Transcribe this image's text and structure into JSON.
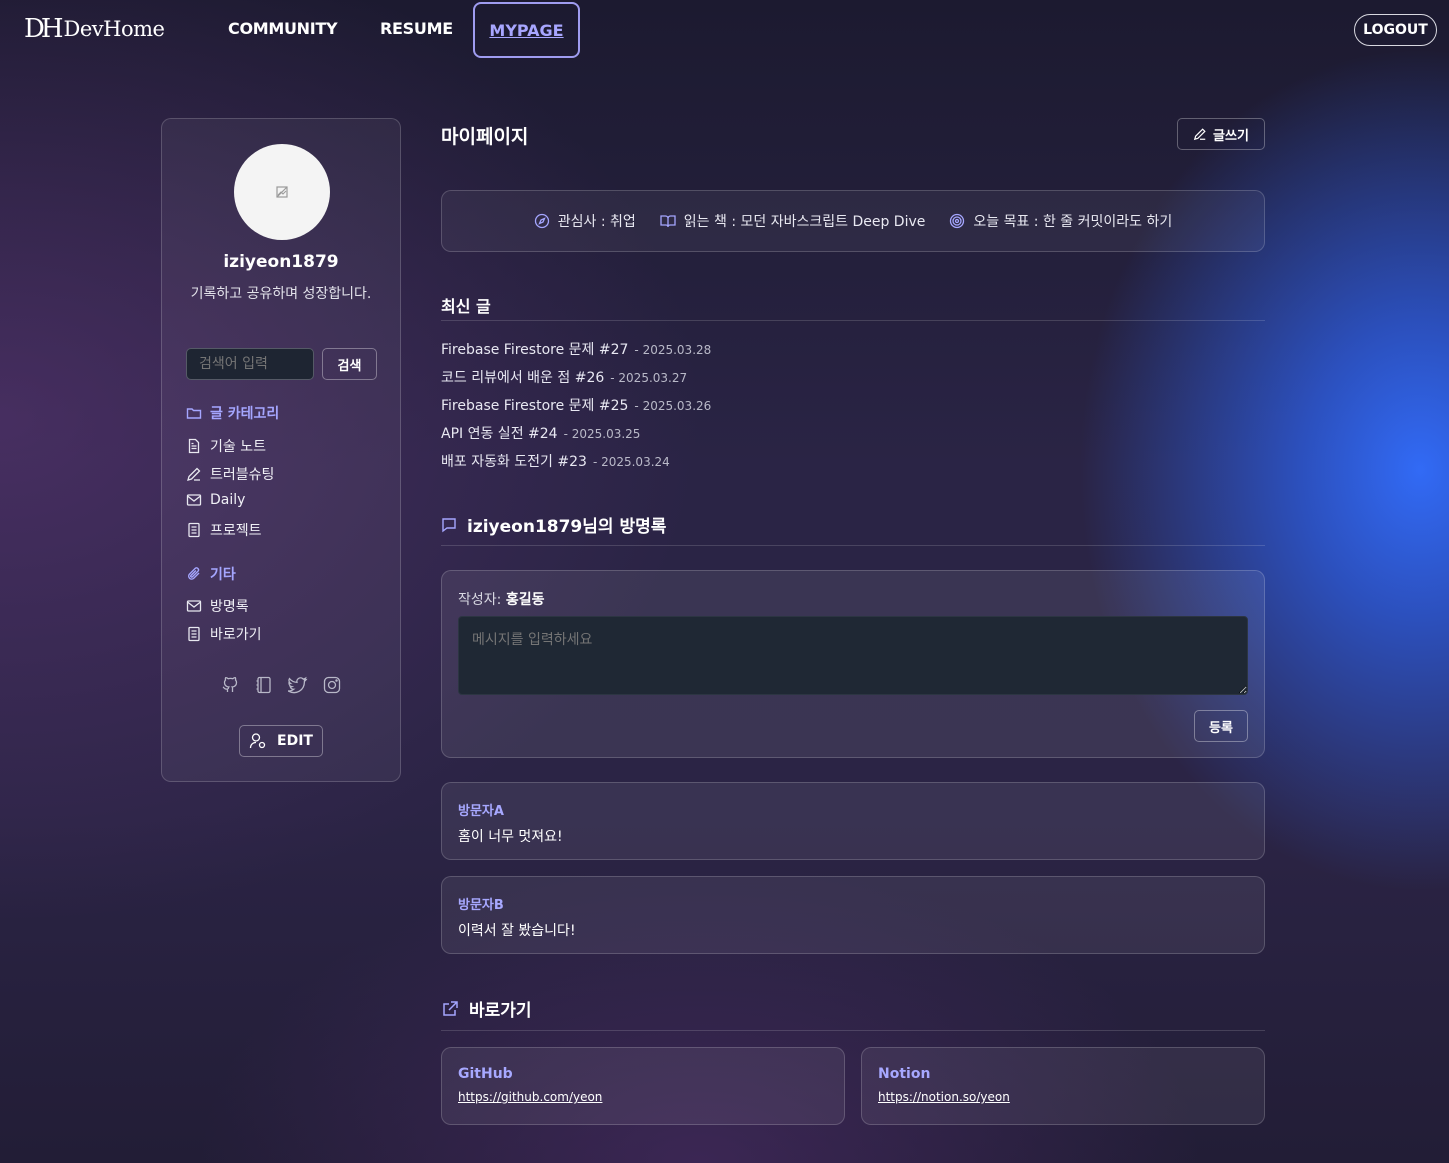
{
  "nav": {
    "logo_mark": "DH",
    "logo_text": "DevHome",
    "links": [
      "COMMUNITY",
      "RESUME",
      "MYPAGE"
    ],
    "logout": "LOGOUT"
  },
  "profile": {
    "username": "iziyeon1879",
    "bio": "기록하고 공유하며 성장합니다.",
    "search_placeholder": "검색어 입력",
    "search_button": "검색",
    "edit_button": "EDIT"
  },
  "categories": {
    "heading": "글 카테고리",
    "items": [
      "기술 노트",
      "트러블슈팅",
      "Daily",
      "프로젝트"
    ]
  },
  "etc": {
    "heading": "기타",
    "items": [
      "방명록",
      "바로가기"
    ]
  },
  "main": {
    "title": "마이페이지",
    "write_button": "글쓰기",
    "info": {
      "interest": "관심사 : 취업",
      "book": "읽는 책 : 모던 자바스크립트 Deep Dive",
      "goal": "오늘 목표 : 한 줄 커밋이라도 하기"
    }
  },
  "recent": {
    "heading": "최신 글",
    "posts": [
      {
        "title": "Firebase Firestore 문제 #27",
        "date": "- 2025.03.28"
      },
      {
        "title": "코드 리뷰에서 배운 점 #26",
        "date": "- 2025.03.27"
      },
      {
        "title": "Firebase Firestore 문제 #25",
        "date": "- 2025.03.26"
      },
      {
        "title": "API 연동 실전 #24",
        "date": "- 2025.03.25"
      },
      {
        "title": "배포 자동화 도전기 #23",
        "date": "- 2025.03.24"
      }
    ]
  },
  "guestbook": {
    "heading": "iziyeon1879님의 방명록",
    "author_label": "작성자:",
    "author_name": "홍길동",
    "placeholder": "메시지를 입력하세요",
    "submit": "등록",
    "entries": [
      {
        "name": "방문자A",
        "message": "홈이 너무 멋져요!"
      },
      {
        "name": "방문자B",
        "message": "이력서 잘 봤습니다!"
      }
    ]
  },
  "shortcuts": {
    "heading": "바로가기",
    "links": [
      {
        "name": "GitHub",
        "url": "https://github.com/yeon"
      },
      {
        "name": "Notion",
        "url": "https://notion.so/yeon"
      }
    ]
  },
  "colors": {
    "accent": "#a5a6ff",
    "background": "#2a2445",
    "glow": "#3a6cff"
  }
}
